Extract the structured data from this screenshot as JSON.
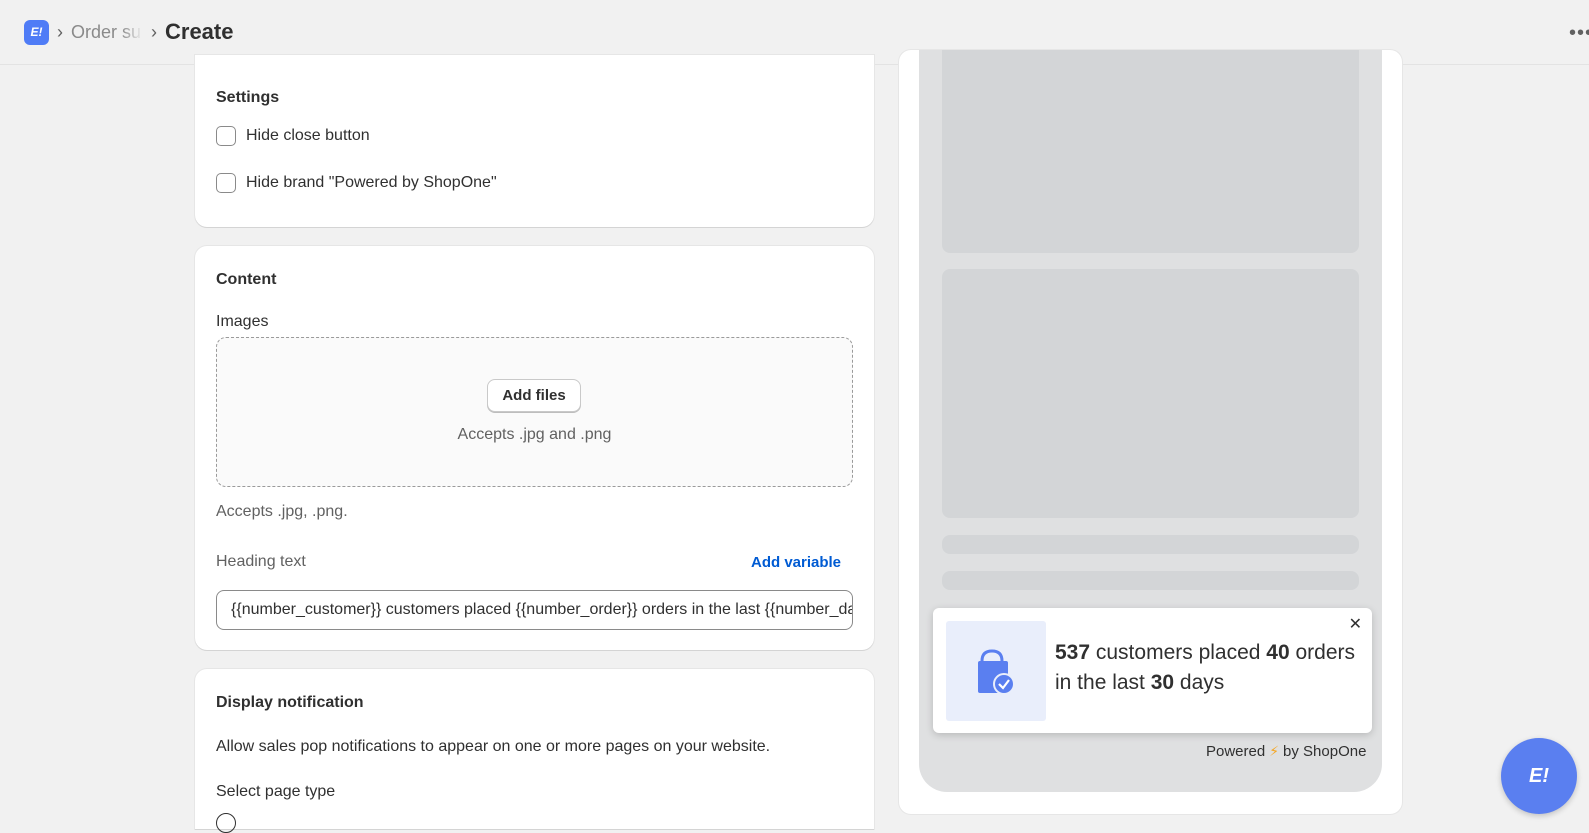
{
  "header": {
    "logo_text": "E!",
    "breadcrumb_prev": "Order su",
    "breadcrumb_current": "Create",
    "more": "•••"
  },
  "settings": {
    "title": "Settings",
    "hide_close_label": "Hide close button",
    "hide_brand_label": "Hide brand \"Powered by ShopOne\""
  },
  "content": {
    "title": "Content",
    "images_label": "Images",
    "add_files_label": "Add files",
    "drop_hint": "Accepts .jpg and .png",
    "accepts_note": "Accepts .jpg, .png.",
    "heading_label": "Heading text",
    "add_variable_label": "Add variable",
    "heading_value": "{{number_customer}} customers placed {{number_order}} orders in the last {{number_day}} days"
  },
  "display": {
    "title": "Display notification",
    "description": "Allow sales pop notifications to appear on one or more pages on your website.",
    "page_type_label": "Select page type"
  },
  "preview": {
    "number_customer": "537",
    "text_customers": " customers placed ",
    "number_order": "40",
    "text_orders": " orders in the last ",
    "number_day": "30",
    "text_days": " days",
    "close": "✕",
    "powered_prefix": "Powered",
    "powered_suffix": "by ShopOne",
    "fab_text": "E!"
  },
  "colors": {
    "accent": "#4f7cf6",
    "link": "#005bd3",
    "fab": "#5a7ff0"
  }
}
